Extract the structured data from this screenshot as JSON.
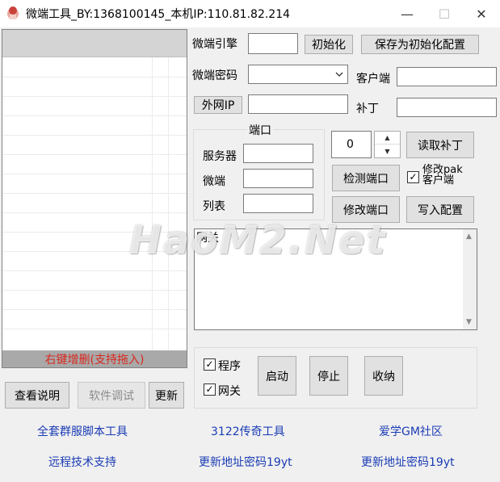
{
  "window": {
    "title": "微端工具_BY:1368100145_本机IP:110.81.82.214",
    "controls": {
      "minimize": "—",
      "maximize": "☐",
      "close": "✕"
    }
  },
  "list_panel": {
    "footer": "右键增删(支持拖入)"
  },
  "bottom_left_buttons": {
    "help": "查看说明",
    "debug": "软件调试",
    "update": "更新"
  },
  "engine": {
    "label": "微端引擎",
    "value": "",
    "init_button": "初始化",
    "save_init_button": "保存为初始化配置"
  },
  "password": {
    "label": "微端密码",
    "value": ""
  },
  "client": {
    "label": "客户端",
    "value": ""
  },
  "external_ip": {
    "button": "外网IP",
    "value": ""
  },
  "patch": {
    "label": "补丁",
    "value": ""
  },
  "ports": {
    "group_title": "端口",
    "server_label": "服务器",
    "server_value": "",
    "micro_label": "微端",
    "micro_value": "",
    "list_label": "列表",
    "list_value": ""
  },
  "spinner": {
    "value": "0"
  },
  "actions": {
    "read_patch": "读取补丁",
    "check_port": "检测端口",
    "modify_port": "修改端口",
    "write_config": "写入配置",
    "modify_pak_label": "修改pak\n客户端",
    "modify_pak_checked": true
  },
  "log": {
    "text": "网关"
  },
  "run": {
    "program_label": "程序",
    "program_checked": true,
    "gateway_label": "网关",
    "gateway_checked": true,
    "start": "启动",
    "stop": "停止",
    "minimize": "收纳"
  },
  "links": {
    "row1": [
      "全套群服脚本工具",
      "3122传奇工具",
      "爱学GM社区"
    ],
    "row2": [
      "远程技术支持",
      "更新地址密码19yt",
      "更新地址密码19yt"
    ]
  },
  "watermark": "HaoM2.Net",
  "colors": {
    "footer_text": "#d8281e",
    "link": "#1a3cb4"
  }
}
